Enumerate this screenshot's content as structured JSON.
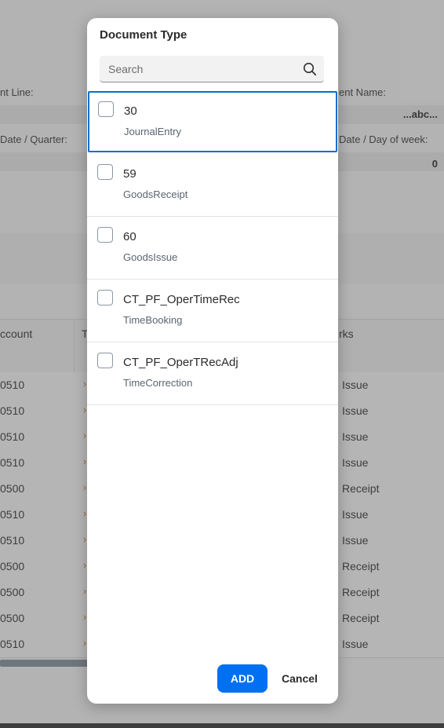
{
  "background": {
    "labels": [
      "nt Line:",
      "ent Name:",
      "Date / Quarter:",
      "Date / Day of week:"
    ],
    "header_right": "...abc...",
    "right_value": "0",
    "columns": [
      "ccount",
      "T",
      "rks"
    ],
    "rows": [
      {
        "acct": "0510",
        "mark": "›",
        "remark": "Issue"
      },
      {
        "acct": "0510",
        "mark": "›",
        "remark": "Issue"
      },
      {
        "acct": "0510",
        "mark": "›",
        "remark": "Issue"
      },
      {
        "acct": "0510",
        "mark": "›",
        "remark": "Issue"
      },
      {
        "acct": "0500",
        "mark": "›",
        "remark": "Receipt"
      },
      {
        "acct": "0510",
        "mark": "›",
        "remark": "Issue"
      },
      {
        "acct": "0510",
        "mark": "›",
        "remark": "Issue"
      },
      {
        "acct": "0500",
        "mark": "›",
        "remark": "Receipt"
      },
      {
        "acct": "0500",
        "mark": "›",
        "remark": "Receipt"
      },
      {
        "acct": "0500",
        "mark": "›",
        "remark": "Receipt"
      },
      {
        "acct": "0510",
        "mark": "›",
        "remark": "Issue"
      }
    ]
  },
  "dialog": {
    "title": "Document Type",
    "search": {
      "placeholder": "Search",
      "value": "",
      "icon": "search-icon"
    },
    "items": [
      {
        "code": "30",
        "desc": "JournalEntry",
        "checked": false
      },
      {
        "code": "59",
        "desc": "GoodsReceipt",
        "checked": false
      },
      {
        "code": "60",
        "desc": "GoodsIssue",
        "checked": false
      },
      {
        "code": "CT_PF_OperTimeRec",
        "desc": "TimeBooking",
        "checked": false
      },
      {
        "code": "CT_PF_OperTRecAdj",
        "desc": "TimeCorrection",
        "checked": false
      }
    ],
    "add_label": "ADD",
    "cancel_label": "Cancel"
  },
  "colors": {
    "accent": "#0070f2",
    "focus": "#0a6ed1",
    "remark_mark": "#c8741f"
  }
}
